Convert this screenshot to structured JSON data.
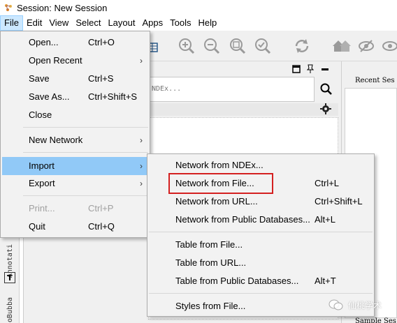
{
  "window": {
    "title": "Session: New Session"
  },
  "menubar": {
    "items": [
      "File",
      "Edit",
      "View",
      "Select",
      "Layout",
      "Apps",
      "Tools",
      "Help"
    ]
  },
  "toolbar": {
    "icons": [
      "table-import-icon",
      "zoom-in-icon",
      "zoom-out-icon",
      "zoom-fit-icon",
      "zoom-selected-icon",
      "refresh-icon",
      "home-icon",
      "hide-icon",
      "show-icon"
    ]
  },
  "search": {
    "placeholder": "NDEx..."
  },
  "right_panel": {
    "recent_label": "Recent Ses",
    "sample_label": "Sample Ses"
  },
  "side_tabs": {
    "annotation": "Annotati",
    "bubba": "oBubba"
  },
  "file_menu": {
    "items": [
      {
        "label": "Open...",
        "shortcut": "Ctrl+O"
      },
      {
        "label": "Open Recent",
        "shortcut": ""
      },
      {
        "label": "Save",
        "shortcut": "Ctrl+S"
      },
      {
        "label": "Save As...",
        "shortcut": "Ctrl+Shift+S"
      },
      {
        "label": "Close",
        "shortcut": ""
      },
      {
        "label": "New Network",
        "shortcut": ""
      },
      {
        "label": "Import",
        "shortcut": ""
      },
      {
        "label": "Export",
        "shortcut": ""
      },
      {
        "label": "Print...",
        "shortcut": "Ctrl+P"
      },
      {
        "label": "Quit",
        "shortcut": "Ctrl+Q"
      }
    ]
  },
  "import_menu": {
    "items": [
      {
        "label": "Network from NDEx...",
        "shortcut": ""
      },
      {
        "label": "Network from File...",
        "shortcut": "Ctrl+L"
      },
      {
        "label": "Network from URL...",
        "shortcut": "Ctrl+Shift+L"
      },
      {
        "label": "Network from Public Databases...",
        "shortcut": "Alt+L"
      },
      {
        "label": "Table from File...",
        "shortcut": ""
      },
      {
        "label": "Table from URL...",
        "shortcut": ""
      },
      {
        "label": "Table from Public Databases...",
        "shortcut": "Alt+T"
      },
      {
        "label": "Styles from File...",
        "shortcut": ""
      }
    ]
  },
  "watermark": {
    "text": "仙桃学术"
  },
  "colors": {
    "highlight": "#91c9f7",
    "annotation_red": "#d42020",
    "menu_bg": "#f2f2f2"
  }
}
